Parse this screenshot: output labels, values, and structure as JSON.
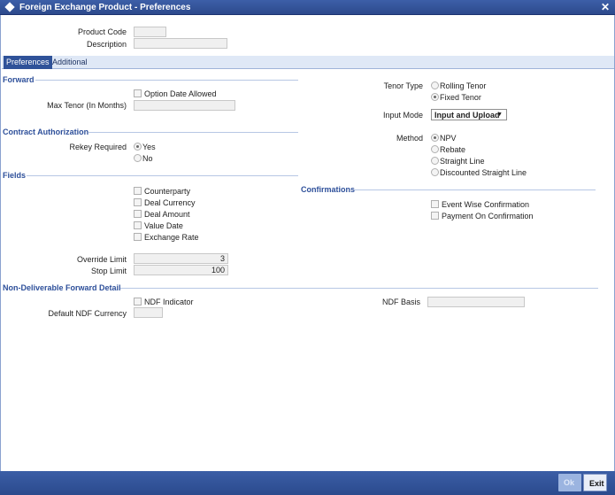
{
  "window": {
    "title": "Foreign Exchange Product - Preferences",
    "close_glyph": "✕"
  },
  "header": {
    "product_code_label": "Product Code",
    "product_code_value": "",
    "description_label": "Description",
    "description_value": ""
  },
  "tabs": [
    {
      "label": "Preferences",
      "active": true
    },
    {
      "label": "Additional",
      "active": false
    }
  ],
  "forward": {
    "section_title": "Forward",
    "option_date_allowed": {
      "label": "Option Date Allowed",
      "checked": false
    },
    "max_tenor_label": "Max Tenor (In Months)",
    "max_tenor_value": "",
    "tenor_type_label": "Tenor Type",
    "tenor_options": [
      {
        "label": "Rolling Tenor",
        "selected": false
      },
      {
        "label": "Fixed Tenor",
        "selected": true
      }
    ],
    "input_mode_label": "Input Mode",
    "input_mode_value": "Input and Upload"
  },
  "contract_authorization": {
    "section_title": "Contract Authorization",
    "rekey_label": "Rekey Required",
    "rekey_options": [
      {
        "label": "Yes",
        "selected": true
      },
      {
        "label": "No",
        "selected": false
      }
    ],
    "method_label": "Method",
    "method_options": [
      {
        "label": "NPV",
        "selected": true
      },
      {
        "label": "Rebate",
        "selected": false
      },
      {
        "label": "Straight Line",
        "selected": false
      },
      {
        "label": "Discounted Straight Line",
        "selected": false
      }
    ]
  },
  "fields": {
    "section_title": "Fields",
    "checkboxes": [
      {
        "label": "Counterparty",
        "checked": false
      },
      {
        "label": "Deal Currency",
        "checked": false
      },
      {
        "label": "Deal Amount",
        "checked": false
      },
      {
        "label": "Value Date",
        "checked": false
      },
      {
        "label": "Exchange Rate",
        "checked": false
      }
    ],
    "override_limit_label": "Override Limit",
    "override_limit_value": "3",
    "stop_limit_label": "Stop Limit",
    "stop_limit_value": "100"
  },
  "confirmations": {
    "section_title": "Confirmations",
    "checkboxes": [
      {
        "label": "Event Wise Confirmation",
        "checked": false
      },
      {
        "label": "Payment On Confirmation",
        "checked": false
      }
    ]
  },
  "ndf": {
    "section_title": "Non-Deliverable Forward Detail",
    "ndf_indicator": {
      "label": "NDF Indicator",
      "checked": false
    },
    "default_ndf_currency_label": "Default NDF Currency",
    "default_ndf_currency_value": "",
    "ndf_basis_label": "NDF Basis",
    "ndf_basis_value": ""
  },
  "footer": {
    "ok_label": "Ok",
    "exit_label": "Exit"
  },
  "colors": {
    "titlebar": "#2d4a8c",
    "section_header": "#2d4f9a",
    "active_tab": "#2f5299",
    "footer": "#2b4a8d"
  }
}
